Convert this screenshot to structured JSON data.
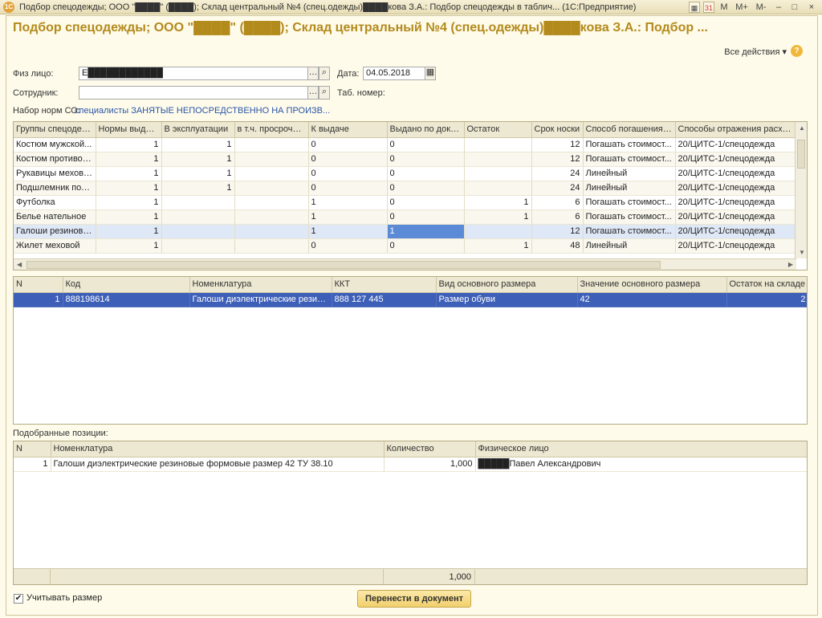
{
  "window": {
    "title": "Подбор спецодежды; ООО \"████\" (████); Склад центральный №4 (спец.одежды)████кова З.А.: Подбор спецодежды в таблич... (1С:Предприятие)",
    "icon_text": "1С",
    "controls": {
      "m": "M",
      "mplus": "M+",
      "mminus": "M-",
      "min": "–",
      "max": "□",
      "close": "×",
      "calc": "▦",
      "cal": "31"
    }
  },
  "heading": "Подбор спецодежды; ООО \"████\" (████); Склад центральный №4 (спец.одежды)████кова З.А.: Подбор ...",
  "all_actions": "Все действия ▾",
  "help": "?",
  "form": {
    "person_label": "Физ лицо:",
    "person_value": "Е████████████",
    "date_label": "Дата:",
    "date_value": "04.05.2018",
    "employee_label": "Сотрудник:",
    "employee_value": "",
    "tabnum_label": "Таб. номер:",
    "norms_label": "Набор норм СО:",
    "norms_value": "специалисты ЗАНЯТЫЕ НЕПОСРЕДСТВЕННО НА ПРОИЗВ..."
  },
  "norms_table": {
    "columns": [
      "Группы спецодеж...",
      "Нормы выдачи",
      "В эксплуатации",
      "в т.ч. просрочено",
      "К выдаче",
      "Выдано по доку...",
      "Остаток",
      "Срок носки",
      "Способ погашения ...",
      "Способы отражения расходов"
    ],
    "rows": [
      [
        "Костюм мужской...",
        "1",
        "1",
        "",
        "0",
        "0",
        "",
        "12",
        "Погашать стоимост...",
        "20/ЦИТС-1/спецодежда"
      ],
      [
        "Костюм противоэ...",
        "1",
        "1",
        "",
        "0",
        "0",
        "",
        "12",
        "Погашать стоимост...",
        "20/ЦИТС-1/спецодежда"
      ],
      [
        "Рукавицы меховые",
        "1",
        "1",
        "",
        "0",
        "0",
        "",
        "24",
        "Линейный",
        "20/ЦИТС-1/спецодежда"
      ],
      [
        "Подшлемник под ...",
        "1",
        "1",
        "",
        "0",
        "0",
        "",
        "24",
        "Линейный",
        "20/ЦИТС-1/спецодежда"
      ],
      [
        "Футболка",
        "1",
        "",
        "",
        "1",
        "0",
        "1",
        "6",
        "Погашать стоимост...",
        "20/ЦИТС-1/спецодежда"
      ],
      [
        "Белье нательное",
        "1",
        "",
        "",
        "1",
        "0",
        "1",
        "6",
        "Погашать стоимост...",
        "20/ЦИТС-1/спецодежда"
      ],
      [
        "Галоши резиновые",
        "1",
        "",
        "",
        "1",
        "1",
        "",
        "12",
        "Погашать стоимост...",
        "20/ЦИТС-1/спецодежда"
      ],
      [
        "Жилет меховой",
        "1",
        "",
        "",
        "0",
        "0",
        "1",
        "48",
        "Линейный",
        "20/ЦИТС-1/спецодежда"
      ]
    ]
  },
  "items_table": {
    "columns": [
      "N",
      "Код",
      "Номенклатура",
      "ККТ",
      "Вид основного размера",
      "Значение основного размера",
      "Остаток на складе"
    ],
    "rows": [
      [
        "1",
        "888198614",
        "Галоши диэлектрические резин...",
        "888 127 445",
        "Размер обуви",
        "42",
        "2"
      ]
    ]
  },
  "selected_label": "Подобранные позиции:",
  "selected_table": {
    "columns": [
      "N",
      "Номенклатура",
      "Количество",
      "Физическое лицо"
    ],
    "rows": [
      [
        "1",
        "Галоши диэлектрические резиновые формовые размер 42 ТУ 38.10",
        "1,000",
        "█████Павел Александрович"
      ]
    ],
    "total": "1,000"
  },
  "consider_size": "Учитывать размер",
  "transfer_button": "Перенести в документ"
}
